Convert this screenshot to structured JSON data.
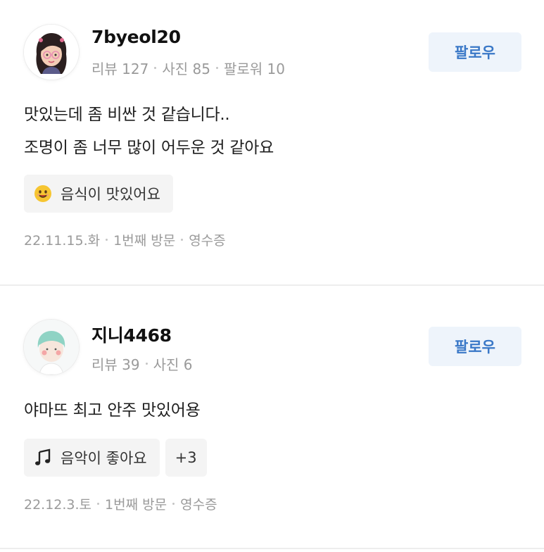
{
  "reviews": [
    {
      "username": "7byeol20",
      "stats": [
        "리뷰 127",
        "사진 85",
        "팔로워 10"
      ],
      "follow_label": "팔로우",
      "text_lines": [
        "맛있는데 좀 비싼 것 같습니다..",
        "조명이 좀 너무 많이 어두운 것 같아요"
      ],
      "chips": [
        {
          "icon": "smiley-icon",
          "label": "음식이 맛있어요"
        }
      ],
      "footer": [
        "22.11.15.화",
        "1번째 방문",
        "영수증"
      ]
    },
    {
      "username": "지니4468",
      "stats": [
        "리뷰 39",
        "사진 6"
      ],
      "follow_label": "팔로우",
      "text_lines": [
        "야마뜨 최고 안주 맛있어용"
      ],
      "chips": [
        {
          "icon": "music-note-icon",
          "label": "음악이 좋아요"
        }
      ],
      "more_chips": "+3",
      "footer": [
        "22.12.3.토",
        "1번째 방문",
        "영수증"
      ]
    }
  ],
  "colors": {
    "follow_bg": "#eef4fb",
    "follow_text": "#3a78c7",
    "chip_bg": "#f4f4f4",
    "meta_text": "#9a9a9a"
  }
}
